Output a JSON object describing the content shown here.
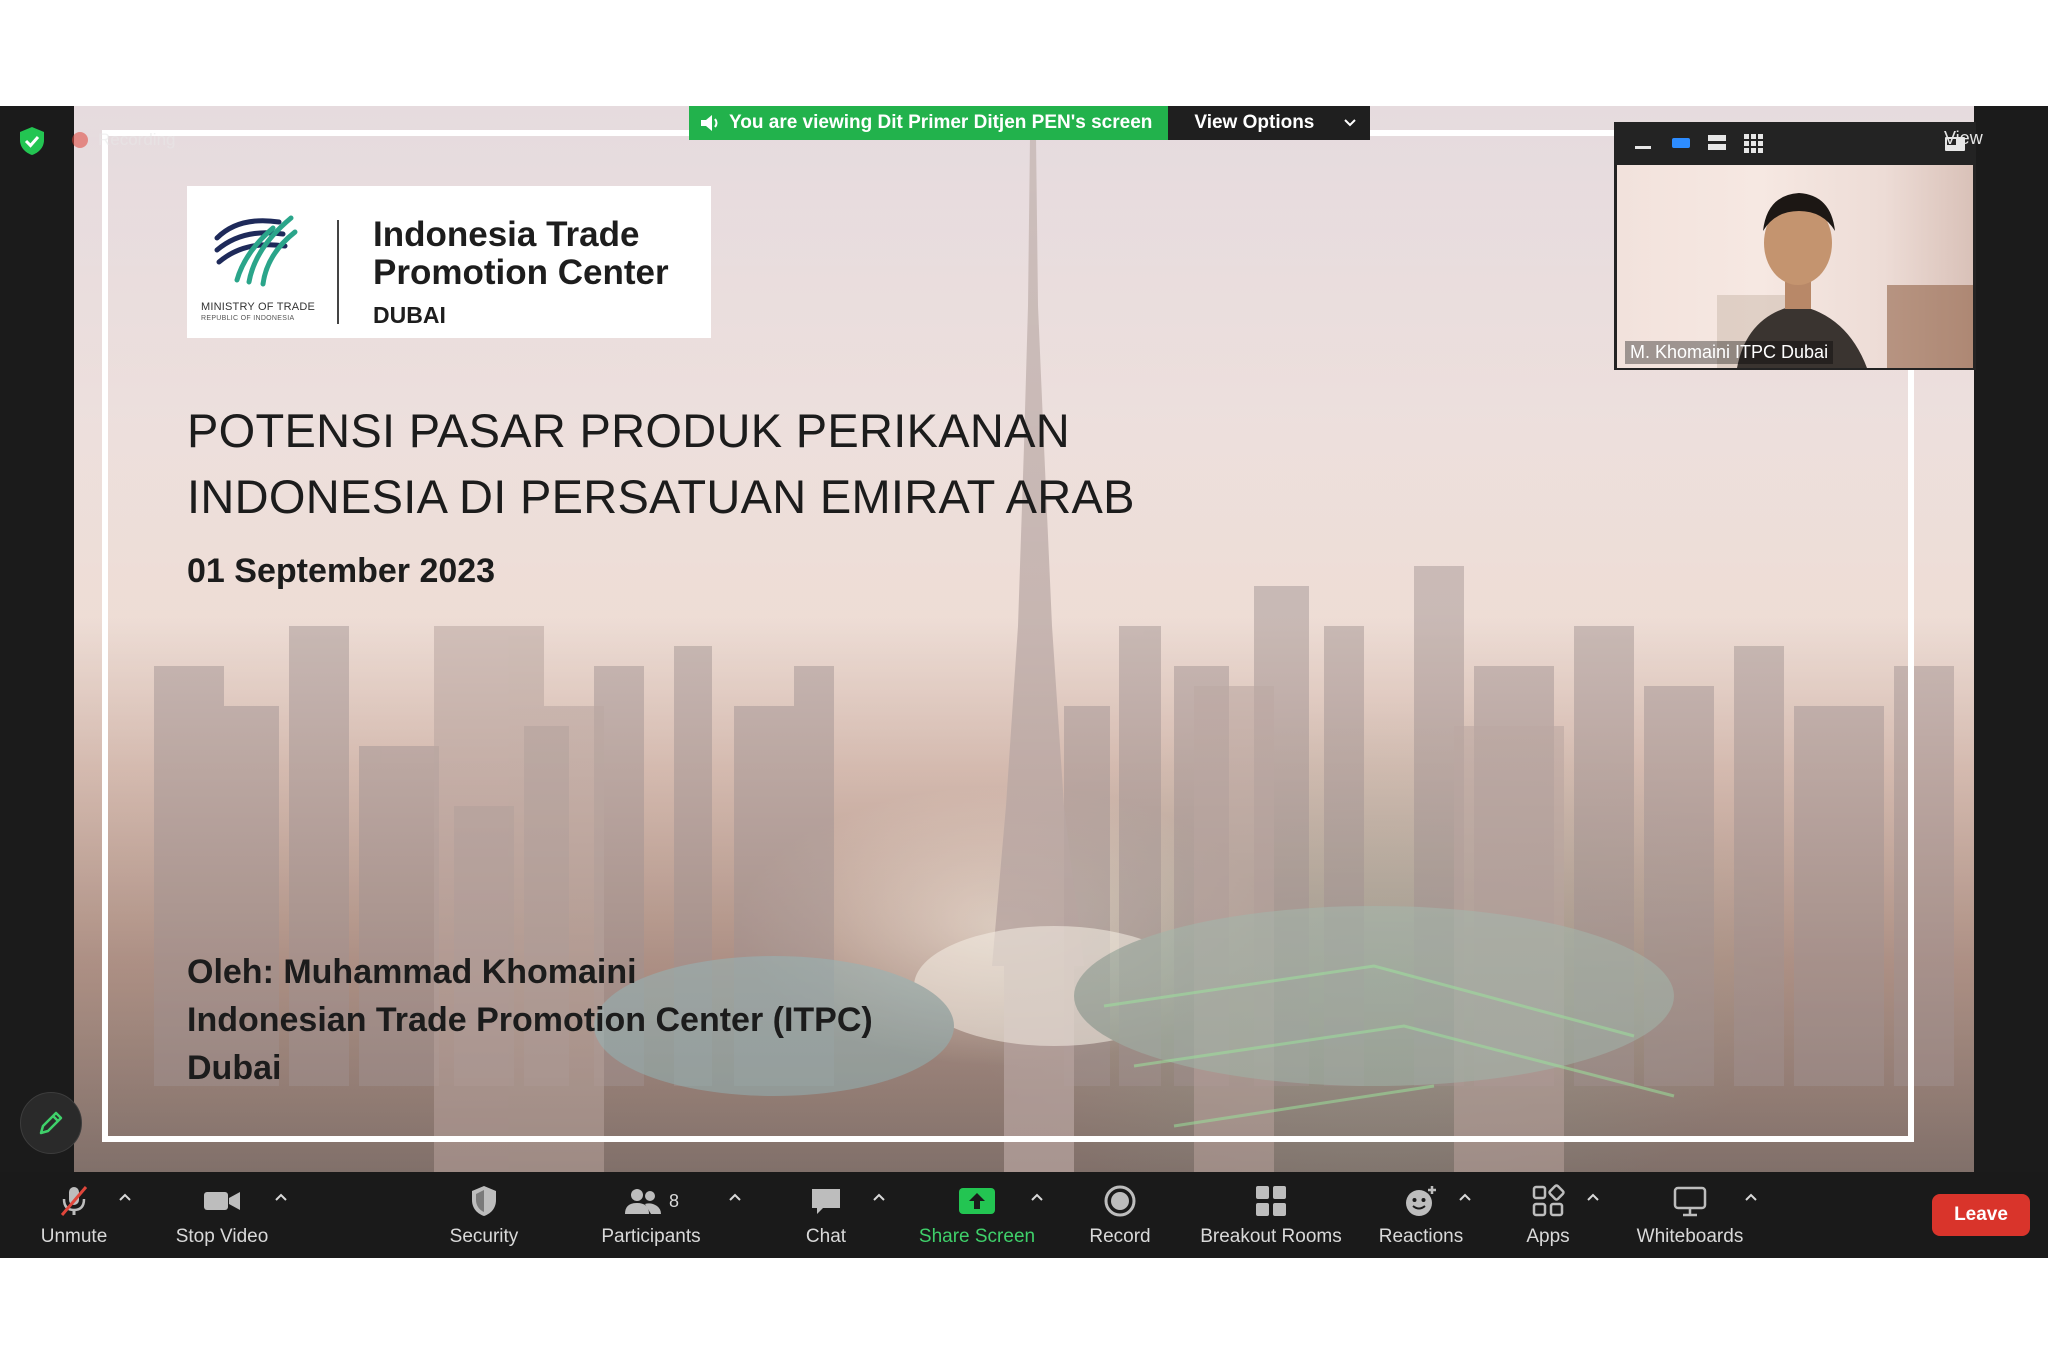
{
  "meeting": {
    "recording_label": "Recording",
    "share_banner": "You are viewing Dit Primer Ditjen PEN's screen",
    "view_options_label": "View Options",
    "view_label": "View"
  },
  "slide": {
    "logo": {
      "org_line1": "Indonesia Trade",
      "org_line2": "Promotion Center",
      "city": "DUBAI",
      "ministry": "MINISTRY OF TRADE",
      "republic": "REPUBLIC OF INDONESIA"
    },
    "title_line1": "POTENSI PASAR PRODUK PERIKANAN",
    "title_line2": "INDONESIA DI PERSATUAN EMIRAT ARAB",
    "date": "01 September 2023",
    "author_line1": "Oleh: Muhammad Khomaini",
    "author_line2": "Indonesian Trade Promotion Center (ITPC)",
    "author_line3": "Dubai"
  },
  "video": {
    "participant_name": "M. Khomaini ITPC Dubai"
  },
  "toolbar": {
    "unmute": "Unmute",
    "stop_video": "Stop Video",
    "security": "Security",
    "participants": "Participants",
    "participant_count": "8",
    "chat": "Chat",
    "share_screen": "Share Screen",
    "record": "Record",
    "breakout_rooms": "Breakout Rooms",
    "reactions": "Reactions",
    "apps": "Apps",
    "whiteboards": "Whiteboards",
    "leave": "Leave"
  },
  "colors": {
    "share_green": "#22b24c",
    "leave_red": "#d9342b",
    "toolbar_bg": "#1a1a1a"
  }
}
